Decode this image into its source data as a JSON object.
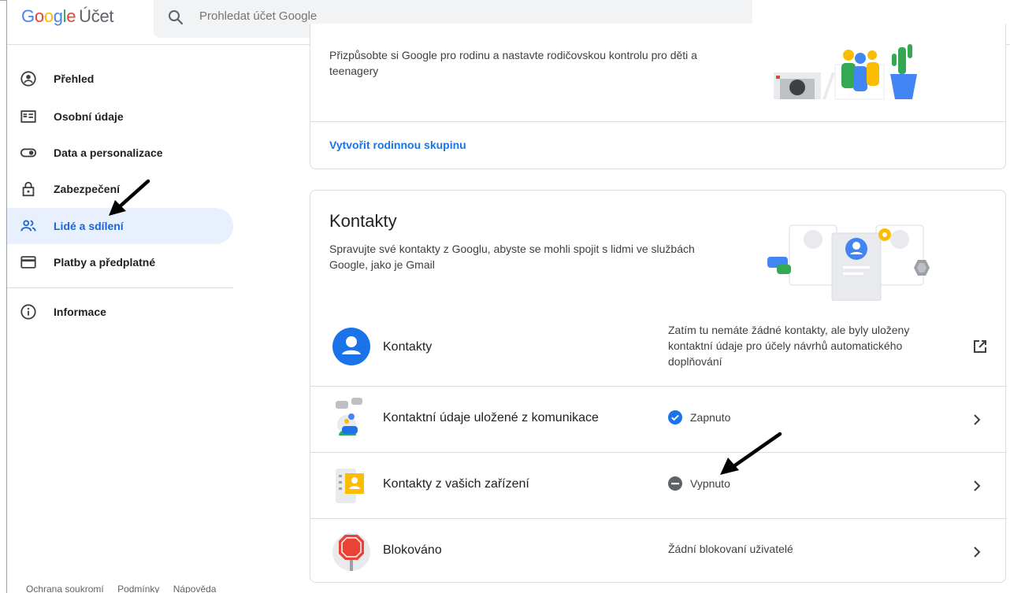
{
  "header": {
    "logo_letters": [
      "G",
      "o",
      "o",
      "g",
      "l",
      "e"
    ],
    "product": "Účet",
    "search_placeholder": "Prohledat účet Google"
  },
  "sidebar": {
    "items": [
      {
        "label": "Přehled",
        "icon": "account-circle-icon"
      },
      {
        "label": "Osobní údaje",
        "icon": "id-card-icon"
      },
      {
        "label": "Data a personalizace",
        "icon": "toggle-icon"
      },
      {
        "label": "Zabezpečení",
        "icon": "lock-icon"
      },
      {
        "label": "Lidé a sdílení",
        "icon": "people-icon",
        "active": true
      },
      {
        "label": "Platby a předplatné",
        "icon": "credit-card-icon"
      },
      {
        "label": "Informace",
        "icon": "info-icon"
      }
    ],
    "footer": [
      "Ochrana soukromí",
      "Podmínky",
      "Nápověda"
    ]
  },
  "family_card": {
    "description": "Přizpůsobte si Google pro rodinu a nastavte rodičovskou kontrolu pro děti a teenagery",
    "link": "Vytvořit rodinnou skupinu"
  },
  "contacts_card": {
    "title": "Kontakty",
    "description": "Spravujte své kontakty z Googlu, abyste se mohli spojit s lidmi ve službách Google, jako je Gmail",
    "rows": [
      {
        "label": "Kontakty",
        "note": "Zatím tu nemáte žádné kontakty, ale byly uloženy kontaktní údaje pro účely návrhů automatického doplňování",
        "action_icon": "open-in-new-icon"
      },
      {
        "label": "Kontaktní údaje uložené z komunikace",
        "status": "Zapnuto",
        "status_icon": "check-circle-icon"
      },
      {
        "label": "Kontakty z vašich zařízení",
        "status": "Vypnuto",
        "status_icon": "minus-circle-icon"
      },
      {
        "label": "Blokováno",
        "status": "Žádní blokovaní uživatelé"
      }
    ]
  },
  "colors": {
    "accent": "#1a73e8",
    "active_bg": "#e8f0fe",
    "active_text": "#1967d2",
    "border": "#dadce0"
  }
}
